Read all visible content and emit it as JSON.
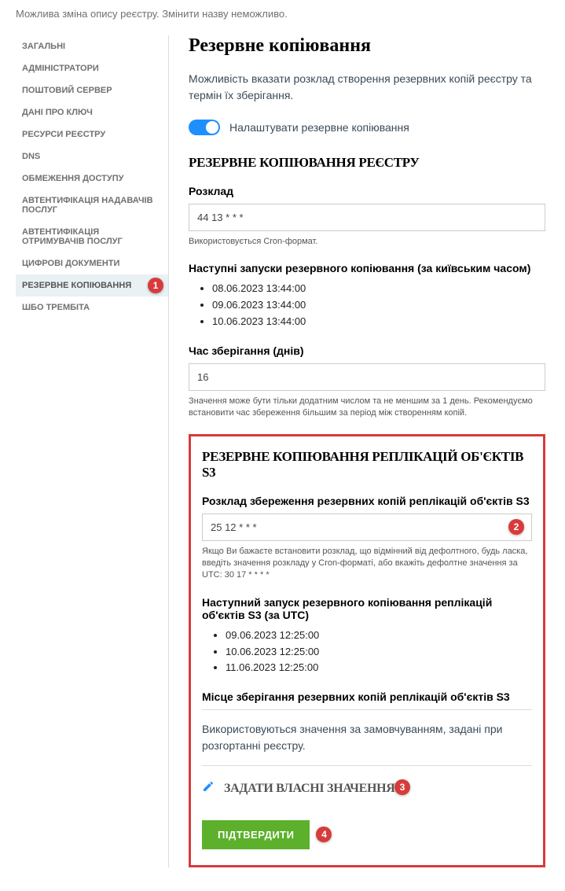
{
  "top_note": "Можлива зміна опису реєстру. Змінити назву неможливо.",
  "sidebar": {
    "items": [
      {
        "label": "ЗАГАЛЬНІ"
      },
      {
        "label": "АДМІНІСТРАТОРИ"
      },
      {
        "label": "ПОШТОВИЙ СЕРВЕР"
      },
      {
        "label": "ДАНІ ПРО КЛЮЧ"
      },
      {
        "label": "РЕСУРСИ РЕЄСТРУ"
      },
      {
        "label": "DNS"
      },
      {
        "label": "ОБМЕЖЕННЯ ДОСТУПУ"
      },
      {
        "label": "АВТЕНТИФІКАЦІЯ НАДАВАЧІВ ПОСЛУГ"
      },
      {
        "label": "АВТЕНТИФІКАЦІЯ ОТРИМУВАЧІВ ПОСЛУГ"
      },
      {
        "label": "ЦИФРОВІ ДОКУМЕНТИ"
      },
      {
        "label": "РЕЗЕРВНЕ КОПІЮВАННЯ"
      },
      {
        "label": "ШБО ТРЕМБІТА"
      }
    ],
    "active_index": 10
  },
  "page": {
    "title": "Резервне копіювання",
    "desc": "Можливість вказати розклад створення резервних копій реєстру та термін їх зберігання.",
    "toggle_label": "Налаштувати резервне копіювання"
  },
  "registry_backup": {
    "heading": "РЕЗЕРВНЕ КОПІЮВАННЯ РЕЄСТРУ",
    "schedule_label": "Розклад",
    "schedule_value": "44 13 * * *",
    "schedule_hint": "Використовується Cron-формат.",
    "next_runs_label": "Наступні запуски резервного копіювання (за київським часом)",
    "next_runs": [
      "08.06.2023 13:44:00",
      "09.06.2023 13:44:00",
      "10.06.2023 13:44:00"
    ],
    "retention_label": "Час зберігання (днів)",
    "retention_value": "16",
    "retention_hint": "Значення може бути тільки додатним числом та не меншим за 1 день. Рекомендуємо встановити час збереження більшим за період між створенням копій."
  },
  "s3_backup": {
    "heading": "РЕЗЕРВНЕ КОПІЮВАННЯ РЕПЛІКАЦІЙ ОБ'ЄКТІВ S3",
    "schedule_label": "Розклад збереження резервних копій реплікацій об'єктів S3",
    "schedule_value": "25 12 * * *",
    "schedule_hint": "Якщо Ви бажаєте встановити розклад, що відмінний від дефолтного, будь ласка, введіть значення розкладу у Cron-форматі, або вкажіть дефолтне значення за UTC: 30 17 * * * *",
    "next_runs_label": "Наступний запуск резервного копіювання реплікацій об'єктів S3 (за UTC)",
    "next_runs": [
      "09.06.2023 12:25:00",
      "10.06.2023 12:25:00",
      "11.06.2023 12:25:00"
    ],
    "storage_label": "Місце зберігання резервних копій реплікацій об'єктів S3",
    "storage_note": "Використовуються значення за замовчуванням, задані при розгортанні реєстру.",
    "custom_values_label": "ЗАДАТИ ВЛАСНІ ЗНАЧЕННЯ"
  },
  "submit_label": "ПІДТВЕРДИТИ",
  "callouts": {
    "c1": "1",
    "c2": "2",
    "c3": "3",
    "c4": "4"
  }
}
